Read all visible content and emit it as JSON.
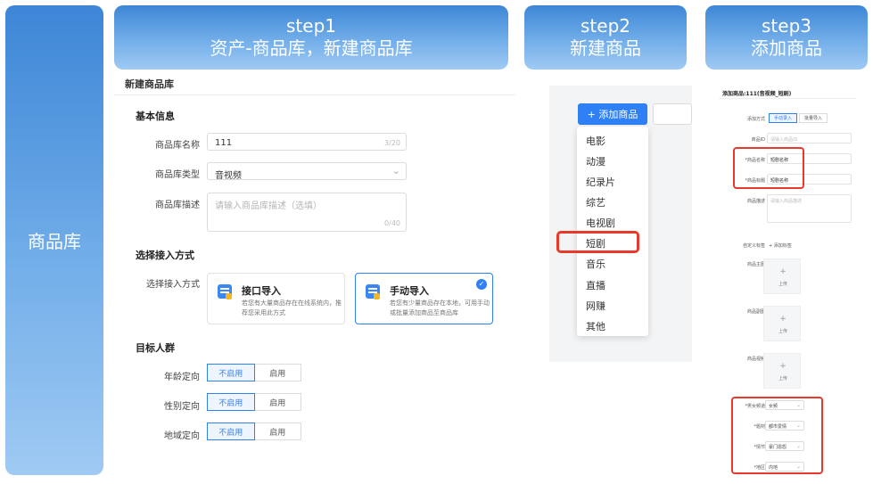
{
  "left_panel": {
    "label": "商品库"
  },
  "step1": {
    "header_line1": "step1",
    "header_line2": "资产-商品库，新建商品库",
    "form": {
      "title": "新建商品库",
      "basic_section": "基本信息",
      "name_label": "商品库名称",
      "name_value": "111",
      "name_count": "3/20",
      "type_label": "商品库类型",
      "type_value": "音视频",
      "desc_label": "商品库描述",
      "desc_placeholder": "请输入商品库描述（选填）",
      "desc_count": "0/40",
      "access_section": "选择接入方式",
      "access_label": "选择接入方式",
      "api_title": "接口导入",
      "api_desc": "若您有大量商品存在在线系统内，推荐您采用此方式",
      "manual_title": "手动导入",
      "manual_desc": "若您有少量商品存在本地，可用手动或批量添加商品至商品库",
      "audience_section": "目标人群",
      "age_label": "年龄定向",
      "gender_label": "性别定向",
      "region_label": "地域定向",
      "off_label": "不启用",
      "on_label": "启用"
    }
  },
  "step2": {
    "header_line1": "step2",
    "header_line2": "新建商品",
    "add_button": "+ 添加商品",
    "menu_items": [
      "电影",
      "动漫",
      "纪录片",
      "综艺",
      "电视剧",
      "短剧",
      "音乐",
      "直播",
      "网赚",
      "其他"
    ]
  },
  "step3": {
    "header_line1": "step3",
    "header_line2": "添加商品",
    "title": "添加商品:111(音视频_短剧)",
    "method_label": "添加方式",
    "manual_btn": "手动录入",
    "batch_btn": "批量导入",
    "id_label": "商品ID",
    "id_placeholder": "请输入商品ID",
    "name_label": "*商品名称",
    "name_value": "短剧名称",
    "heading_label": "*商品标题",
    "heading_value": "短剧名称",
    "desc_label": "商品描述",
    "desc_placeholder": "请输入商品描述",
    "tag_label": "自定义标签",
    "tag_add": "+ 添加标签",
    "main_img_label": "商品主图",
    "sub_img_label": "商品副图",
    "video_label": "商品视频",
    "upload_label": "上传",
    "channel_label": "*男女频道",
    "channel_value": "女频",
    "theme_label": "*题材",
    "theme_value": "都市爱情",
    "plot_label": "*情节",
    "plot_value": "豪门恩怨",
    "region_label": "*地区",
    "region_value": "内地"
  },
  "colors": {
    "accent": "#2f7ff5",
    "highlight": "#e8392b",
    "header_gradient_top": "#3d86d6",
    "header_gradient_bottom": "#9fcaf3"
  }
}
